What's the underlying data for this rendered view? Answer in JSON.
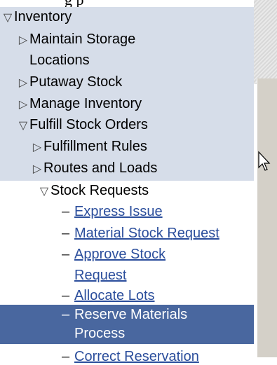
{
  "menu": {
    "items": [
      {
        "label": "Inventory",
        "glyph": "▽"
      },
      {
        "label": "Maintain Storage",
        "glyph": "▷"
      },
      {
        "label": "Locations"
      },
      {
        "label": "Putaway Stock",
        "glyph": "▷"
      },
      {
        "label": "Manage Inventory",
        "glyph": "▷"
      },
      {
        "label": "Fulfill Stock Orders",
        "glyph": "▽"
      },
      {
        "label": "Fulfillment Rules",
        "glyph": "▷"
      },
      {
        "label": "Routes and Loads",
        "glyph": "▷"
      },
      {
        "label": "Stock Requests",
        "glyph": "▽"
      },
      {
        "label": "Express Issue",
        "dash": "–"
      },
      {
        "label": "Material Stock Request",
        "dash": "–"
      },
      {
        "label": "Approve Stock",
        "dash": "–"
      },
      {
        "label": "Request"
      },
      {
        "label": "Allocate Lots",
        "dash": "–"
      },
      {
        "label": "Reserve Materials",
        "dash": "–"
      },
      {
        "label": "Process"
      },
      {
        "label": "Correct Reservation",
        "dash": "–"
      }
    ]
  },
  "colors": {
    "folder_bg": "#d6dde9",
    "link": "#2b4e9c",
    "selected_bg": "#49679f",
    "selected_text": "#ffffff"
  }
}
